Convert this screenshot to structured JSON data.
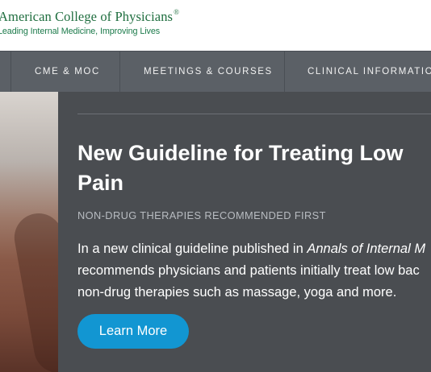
{
  "brand": {
    "name": "American College of Physicians",
    "registered": "®",
    "tagline": "Leading Internal Medicine, Improving Lives"
  },
  "nav": {
    "items": [
      {
        "label": "CME & MOC"
      },
      {
        "label": "MEETINGS & COURSES"
      },
      {
        "label": "CLINICAL INFORMATION"
      }
    ]
  },
  "hero": {
    "headline_line1": "New Guideline for Treating Low",
    "headline_line2": "Pain",
    "subhead": "NON-DRUG THERAPIES RECOMMENDED FIRST",
    "body_line1_prefix": "In a new clinical guideline published in ",
    "body_line1_journal": "Annals of Internal M",
    "body_line2": "recommends physicians and patients initially treat low bac",
    "body_line3": "non-drug therapies such as massage, yoga and more.",
    "cta_label": "Learn More"
  },
  "colors": {
    "brand_green": "#1f6e3f",
    "nav_bg": "#5b6066",
    "hero_bg": "#4a4d51",
    "cta_blue": "#1296d2"
  }
}
